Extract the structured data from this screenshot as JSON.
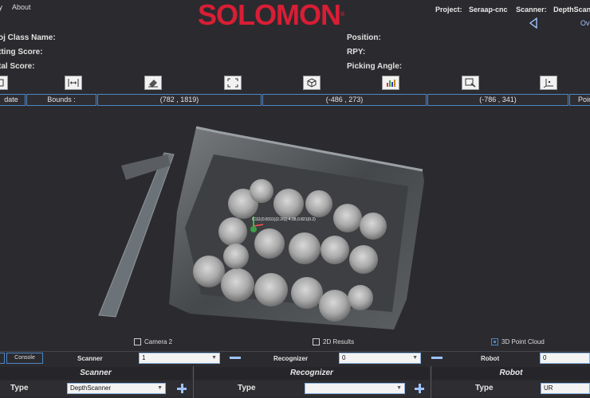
{
  "menu": {
    "item1": "ify",
    "item2": "About"
  },
  "brand": {
    "logo_text": "SOLOMON",
    "reg_mark": "®",
    "color": "#d81e35"
  },
  "project": {
    "project_label": "Project:",
    "project_value": "Seraap-cnc",
    "scanner_label": "Scanner:",
    "scanner_value": "DepthScann"
  },
  "nav": {
    "overflow_label": "Ov"
  },
  "info": {
    "obj_class_label": "oj Class Name:",
    "setting_score_label": "tting Score:",
    "total_score_label": "tal Score:",
    "position_label": "Position:",
    "rpy_label": "RPY:",
    "picking_angle_label": "Picking Angle:"
  },
  "toolbar": {
    "icons": [
      "tool-icon",
      "fit-width-icon",
      "eraser-icon",
      "expand-icon",
      "cube-icon",
      "color-map-icon",
      "zoom-region-icon",
      "axis-icon"
    ]
  },
  "bounds": {
    "update_label": "date",
    "bounds_label": "Bounds :",
    "x_range": "(782 , 1819)",
    "y_range": "(-486 , 273)",
    "z_range": "(-786 , 341)",
    "point_label": "Poin"
  },
  "viewport": {
    "overlay_text": "C111(0.8311)(2.26)(-4.98,0.821(0.2)"
  },
  "view_toggles": {
    "camera2": "Camera 2",
    "results2d": "2D Results",
    "point_cloud": "3D Point Cloud"
  },
  "controls": {
    "console_label": "Console",
    "scanner_label": "Scanner",
    "scanner_value": "1",
    "recognizer_label": "Recognizer",
    "recognizer_value": "0",
    "robot_label": "Robot",
    "robot_value": "0"
  },
  "panels": {
    "scanner_title": "Scanner",
    "scanner_type_label": "Type",
    "scanner_type_value": "DepthScanner",
    "recognizer_title": "Recognizer",
    "recognizer_type_label": "Type",
    "recognizer_type_value": "",
    "robot_title": "Robot",
    "robot_type_label": "Type",
    "robot_type_value": "UR"
  },
  "colors": {
    "accent": "#4d86c4",
    "accent_light": "#9ec3ff",
    "background": "#2b2b2f"
  }
}
